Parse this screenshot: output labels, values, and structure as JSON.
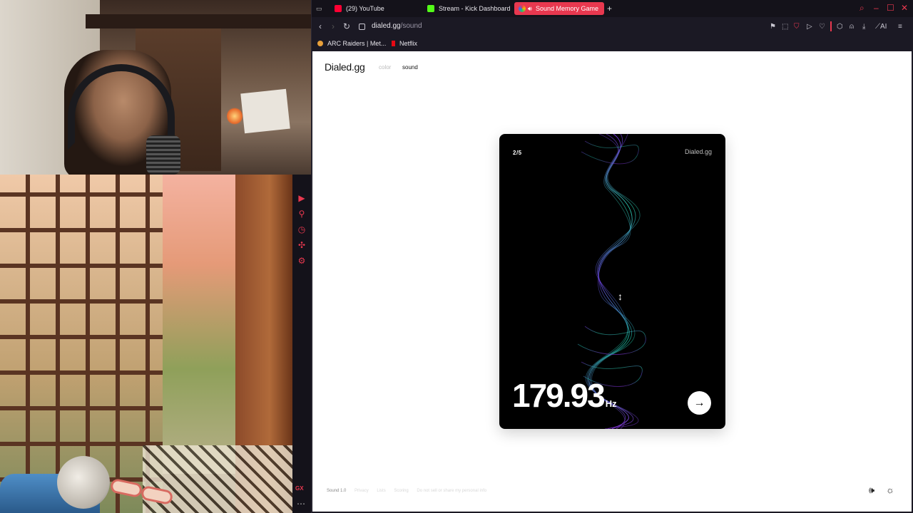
{
  "browser": {
    "tabs": [
      {
        "label": "(29) YouTube",
        "icon": "youtube-icon",
        "color": "#ff0033"
      },
      {
        "label": "Stream - Kick Dashboard",
        "icon": "kick-icon",
        "color": "#53fc18"
      },
      {
        "label": "Sound Memory Game",
        "icon": "dialed-icon",
        "active": true
      }
    ],
    "url_host": "dialed.gg",
    "url_path": "/sound",
    "bookmarks": [
      "ARC Raiders | Met...",
      "Netflix"
    ],
    "accent": "#e8384f",
    "ai_label": "AI",
    "sidebar_badge": "GX"
  },
  "site": {
    "logo": "Dialed.gg",
    "nav": {
      "color": "color",
      "sound": "sound"
    }
  },
  "card": {
    "progress": "2/5",
    "brand": "Dialed.gg",
    "frequency": "179.93",
    "unit": "Hz"
  },
  "footer": {
    "items": [
      "Sound 1.0",
      "Privacy",
      "Lists",
      "Scoring",
      "Do not sell or share my personal info"
    ]
  }
}
